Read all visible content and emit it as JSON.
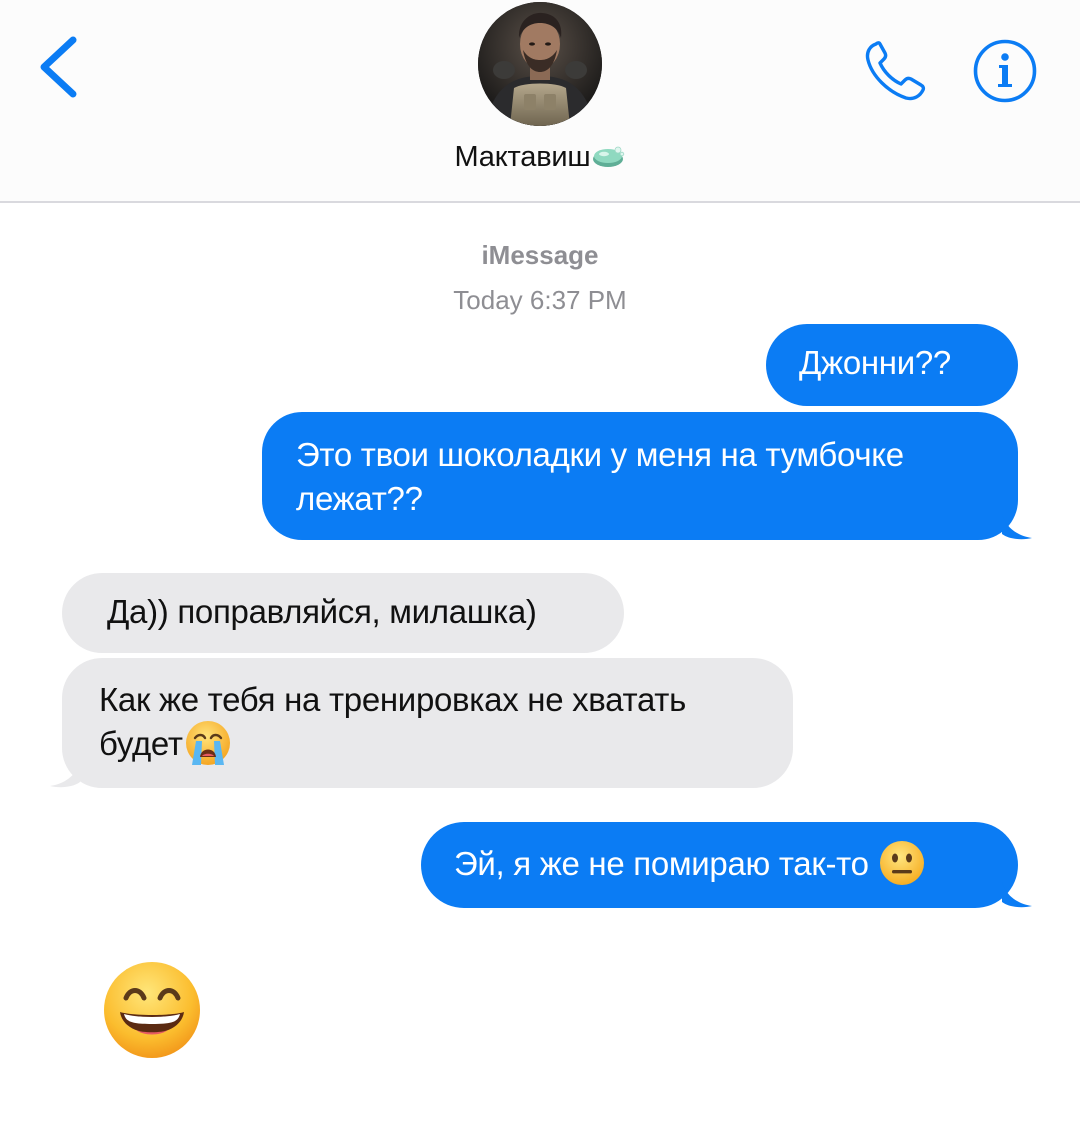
{
  "header": {
    "contact_name": "Мактавиш",
    "contact_suffix_icon": "soap-icon",
    "avatar_icon": "contact-avatar",
    "back_icon": "chevron-left-icon",
    "call_icon": "phone-icon",
    "info_icon": "info-icon"
  },
  "thread": {
    "service": "iMessage",
    "timestamp": "Today 6:37 PM"
  },
  "messages": [
    {
      "direction": "outgoing",
      "text": "Джонни??"
    },
    {
      "direction": "outgoing",
      "text": "Это твои шоколадки у меня на тумбочке\nлежат??"
    },
    {
      "direction": "incoming",
      "text": "Да)) поправляйся, милашка)"
    },
    {
      "direction": "incoming",
      "text": "Как же тебя на тренировках не хватать\nбудет",
      "trailing_emoji": "loudly-crying-face-emoji"
    },
    {
      "direction": "outgoing",
      "text": "Эй, я же не помираю так-то ",
      "trailing_emoji": "neutral-face-emoji"
    },
    {
      "direction": "incoming",
      "emoji_only": "grinning-squinting-face-emoji"
    }
  ],
  "colors": {
    "accent": "#0b7cf4",
    "incoming_bubble": "#e9e9eb",
    "outgoing_bubble": "#0b7cf4",
    "meta_text": "#8e8e93",
    "divider": "#d9d9de"
  }
}
